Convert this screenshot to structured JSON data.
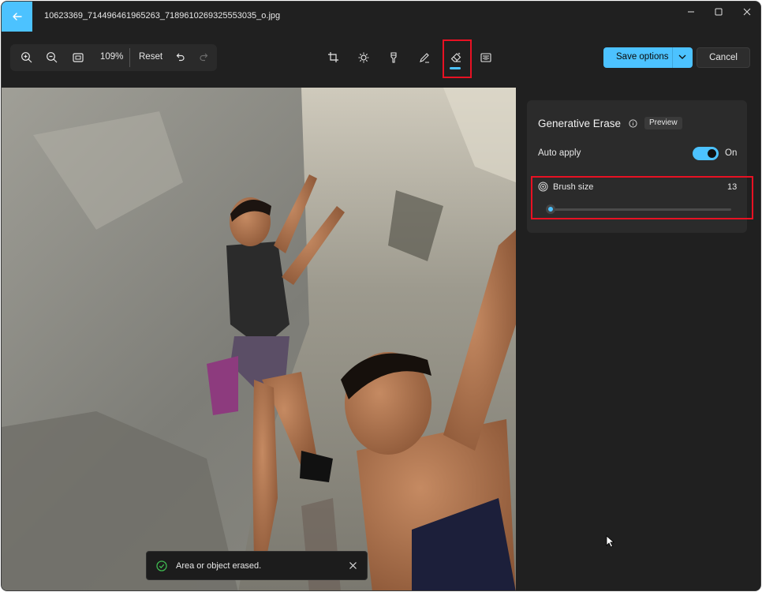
{
  "window": {
    "title": "10623369_714496461965263_7189610269325553035_o.jpg"
  },
  "toolbar": {
    "zoom_level": "109%",
    "reset_label": "Reset",
    "save_label": "Save options",
    "cancel_label": "Cancel"
  },
  "panel": {
    "title": "Generative Erase",
    "preview_badge": "Preview",
    "auto_apply_label": "Auto apply",
    "auto_apply_state": "On",
    "auto_apply_on": true,
    "brush_size_label": "Brush size",
    "brush_size_value": "13"
  },
  "toast": {
    "message": "Area or object erased."
  },
  "colors": {
    "accent": "#4cc2ff",
    "highlight": "#e81123",
    "toast_success": "#3fb950"
  }
}
